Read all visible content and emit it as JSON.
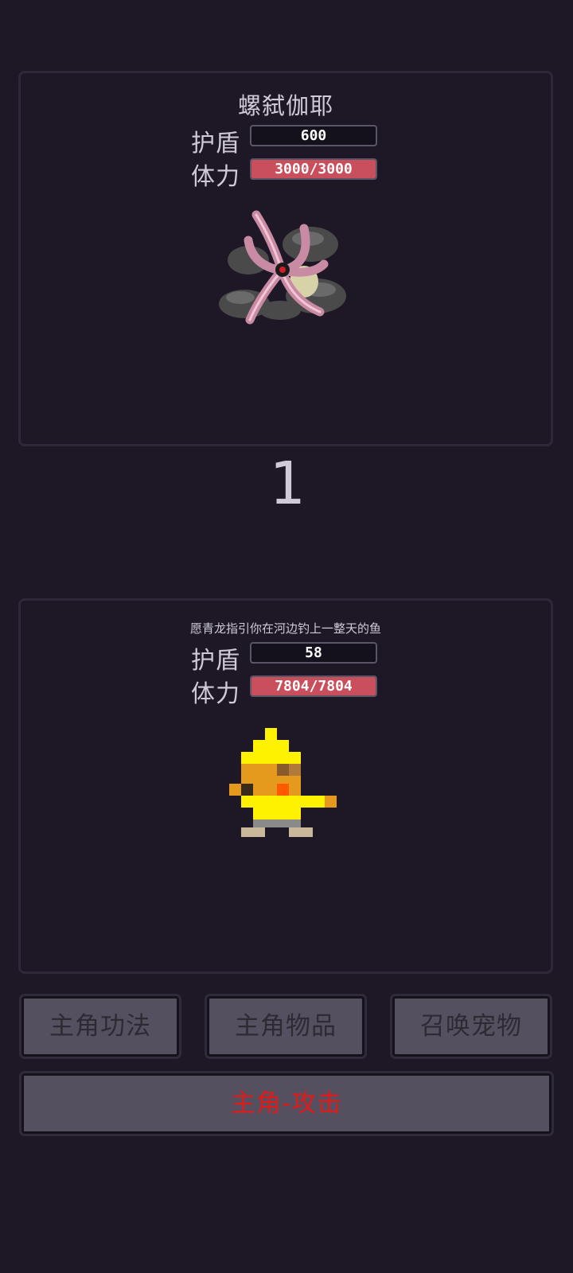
{
  "enemy": {
    "name": "螺弑伽耶",
    "shield_label": "护盾",
    "shield_value": "600",
    "hp_label": "体力",
    "hp_text": "3000/3000",
    "hp_fraction": 1.0
  },
  "round_counter": "1",
  "player": {
    "name": "愿青龙指引你在河边钓上一整天的鱼",
    "shield_label": "护盾",
    "shield_value": "58",
    "hp_label": "体力",
    "hp_text": "7804/7804",
    "hp_fraction": 1.0
  },
  "actions": {
    "skills": "主角功法",
    "items": "主角物品",
    "summon_pet": "召唤宠物",
    "attack": "主角-攻击"
  },
  "colors": {
    "background": "#1e1826",
    "hp_fill": "#c94f5c",
    "attack_text": "#e01a1a",
    "button_bg": "#55505f"
  }
}
